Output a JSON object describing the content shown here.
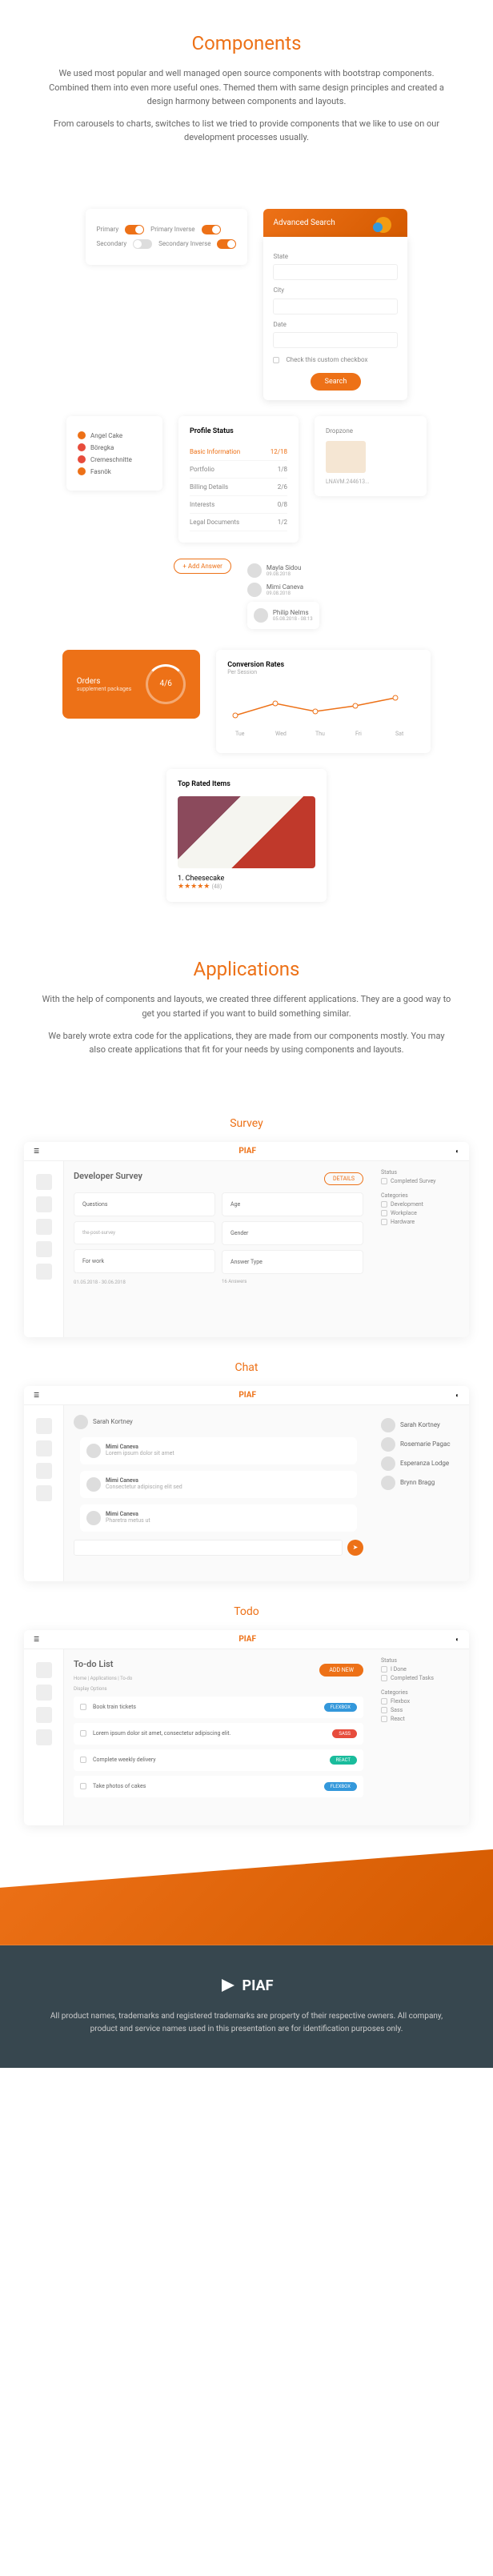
{
  "components": {
    "title": "Components",
    "desc1": "We used most popular and well managed open source components with bootstrap components. Combined them into even more useful ones. Themed them with same design principles and created a design harmony between components and layouts.",
    "desc2": "From carousels to charts, switches to list we tried to provide components that we like to use on our development processes usually."
  },
  "switches": {
    "primary": "Primary",
    "primary_inverse": "Primary Inverse",
    "secondary": "Secondary",
    "secondary_inverse": "Secondary Inverse"
  },
  "adv_search": {
    "title": "Advanced Search",
    "state": "State",
    "city": "City",
    "date": "Date",
    "checkbox": "Check this custom checkbox",
    "button": "Search"
  },
  "tags": {
    "t1": "Angel Cake",
    "t2": "Böregka",
    "t3": "Cremeschnitte",
    "t4": "Fasnök"
  },
  "profile_status": {
    "title": "Profile Status",
    "rows": [
      {
        "label": "Basic Information",
        "val": "12/18"
      },
      {
        "label": "Portfolio",
        "val": "1/8"
      },
      {
        "label": "Billing Details",
        "val": "2/6"
      },
      {
        "label": "Interests",
        "val": "0/8"
      },
      {
        "label": "Legal Documents",
        "val": "1/2"
      }
    ]
  },
  "orders": {
    "label": "Orders",
    "sub": "supplement packages",
    "value": "4/6"
  },
  "avatars": {
    "a1": {
      "name": "Mayla Sidou",
      "date": "09.08.2018"
    },
    "a2": {
      "name": "Mimi Caneva",
      "date": "09.08.2018"
    },
    "a3": {
      "name": "Philip Nelms",
      "date": "05.08.2018 - 08:13"
    }
  },
  "dropzone": {
    "title": "Dropzone",
    "file": "LNAVM.244613..."
  },
  "btn_add": "+ Add Answer",
  "chart": {
    "title": "Conversion Rates",
    "sub": "Per Session"
  },
  "chart_data": {
    "type": "line",
    "categories": [
      "Tue",
      "Wed",
      "Thu",
      "Fri",
      "Sat"
    ],
    "values": [
      45,
      62,
      50,
      58,
      70
    ],
    "title": "Conversion Rates",
    "ylim": [
      0,
      100
    ]
  },
  "top_rated": {
    "title": "Top Rated Items",
    "item": "1. Cheesecake",
    "rating_count": "(48)"
  },
  "applications": {
    "title": "Applications",
    "desc1": "With the help of components and layouts, we created three different applications. They are a good way to get you started if you want to build something similar.",
    "desc2": "We barely wrote extra code for the applications, they are made from our components mostly. You may also create applications that fit for your needs by using components and layouts."
  },
  "survey": {
    "title": "Survey",
    "logo": "PIAF",
    "page_title": "Developer Survey",
    "details_btn": "DETAILS",
    "q1": "Questions",
    "q2": "Age",
    "opt1slug": "the-post-survey",
    "q3": "For work",
    "q4": "Gender",
    "q5": "Answer Type",
    "right": {
      "status": "Status",
      "r1": "Completed Survey",
      "r2": "Categories",
      "cat1": "Development",
      "cat2": "Workplace",
      "cat3": "Hardware"
    },
    "date": "01.05.2018 - 30.06.2018",
    "ans_count": "16 Answers"
  },
  "chat": {
    "title": "Chat",
    "logo": "PIAF",
    "contact": "Sarah Kortney",
    "m1": "Mimi Caneva",
    "m2": "Mimi Caneva",
    "m3": "Mimi Caneva",
    "c1": "Sarah Kortney",
    "c2": "Rosemarie Pagac",
    "c3": "Esperanza Lodge",
    "c4": "Brynn Bragg"
  },
  "todo": {
    "title": "Todo",
    "logo": "PIAF",
    "page_title": "To-do List",
    "breadcrumb": "Home | Applications | To-do",
    "add_new": "ADD NEW",
    "options": "Display Options",
    "t1": "Book train tickets",
    "t2": "Lorem ipsum dolor sit amet, consectetur adipiscing elit.",
    "t3": "Complete weekly delivery",
    "t4": "Take photos of cakes",
    "right": {
      "status": "Status",
      "r1": "I Done",
      "r2": "Completed Tasks",
      "cat": "Categories",
      "c1": "Flexbox",
      "c2": "Sass",
      "c3": "React"
    }
  },
  "footer": {
    "logo": "PIAF",
    "text": "All product names, trademarks and registered trademarks are property of their respective owners. All company, product and service names used in this presentation are for identification purposes only."
  }
}
